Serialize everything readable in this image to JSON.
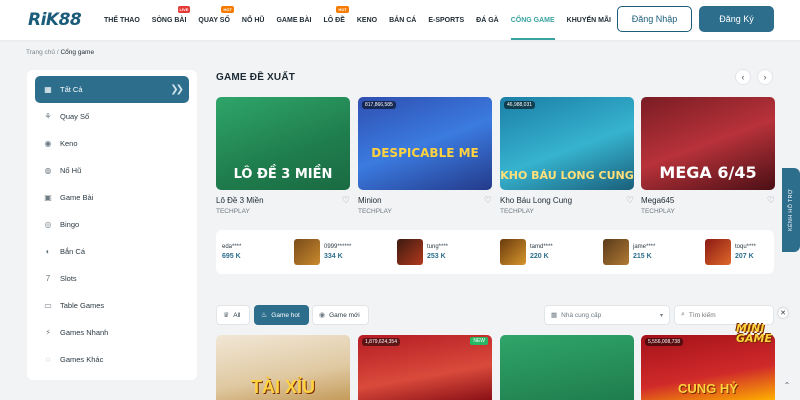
{
  "header": {
    "logo": "RiK88",
    "nav": [
      {
        "label": "THỂ THAO",
        "badge": ""
      },
      {
        "label": "SÒNG BÀI",
        "badge": "LIVE"
      },
      {
        "label": "QUAY SỐ",
        "badge": "HOT"
      },
      {
        "label": "NỔ HŨ",
        "badge": ""
      },
      {
        "label": "GAME BÀI",
        "badge": ""
      },
      {
        "label": "LÔ ĐỀ",
        "badge": "HOT"
      },
      {
        "label": "KENO",
        "badge": ""
      },
      {
        "label": "BẮN CÁ",
        "badge": ""
      },
      {
        "label": "E-SPORTS",
        "badge": ""
      },
      {
        "label": "ĐÁ GÀ",
        "badge": ""
      },
      {
        "label": "CỔNG GAME",
        "badge": ""
      },
      {
        "label": "KHUYẾN MÃI",
        "badge": ""
      }
    ],
    "active_nav": "CỔNG GAME",
    "login": "Đăng Nhập",
    "register": "Đăng Ký"
  },
  "breadcrumb": {
    "home": "Trang chủ",
    "sep": "/",
    "current": "Cổng game"
  },
  "sidebar": {
    "items": [
      {
        "label": "Tất Cả",
        "icon": "grid-icon"
      },
      {
        "label": "Quay Số",
        "icon": "lottery-icon"
      },
      {
        "label": "Keno",
        "icon": "keno-icon"
      },
      {
        "label": "Nổ Hũ",
        "icon": "jackpot-icon"
      },
      {
        "label": "Game Bài",
        "icon": "cards-icon"
      },
      {
        "label": "Bingo",
        "icon": "bingo-icon"
      },
      {
        "label": "Bắn Cá",
        "icon": "fish-icon"
      },
      {
        "label": "Slots",
        "icon": "slot-icon"
      },
      {
        "label": "Table Games",
        "icon": "table-icon"
      },
      {
        "label": "Games Nhanh",
        "icon": "fast-icon"
      },
      {
        "label": "Games Khác",
        "icon": "other-icon"
      }
    ]
  },
  "featured": {
    "title": "GAME ĐỀ XUẤT",
    "games": [
      {
        "name": "Lô Đề 3 Miền",
        "provider": "TECHPLAY",
        "views": "",
        "art": "LÔ ĐỀ 3 MIỀN"
      },
      {
        "name": "Minion",
        "provider": "TECHPLAY",
        "views": "817,866,585",
        "art": "DESPICABLE ME"
      },
      {
        "name": "Kho Báu Long Cung",
        "provider": "TECHPLAY",
        "views": "46,988,031",
        "art": "KHO BÁU LONG CUNG"
      },
      {
        "name": "Mega645",
        "provider": "TECHPLAY",
        "views": "",
        "art": "MEGA 6/45"
      }
    ]
  },
  "winners": [
    {
      "name": "eda****",
      "amount": "695 K"
    },
    {
      "name": "0999******",
      "amount": "334 K"
    },
    {
      "name": "tung****",
      "amount": "253 K"
    },
    {
      "name": "tamd****",
      "amount": "220 K"
    },
    {
      "name": "jame****",
      "amount": "215 K"
    },
    {
      "name": "toqu****",
      "amount": "207 K"
    }
  ],
  "filters": {
    "all": "All",
    "hot": "Game hot",
    "new": "Game mới",
    "provider_placeholder": "Nhà cung cấp",
    "search_placeholder": "Tìm kiếm"
  },
  "bottom_games": [
    {
      "views": "",
      "art": "TÀI XỈU",
      "tag": ""
    },
    {
      "views": "1,879,624,354",
      "art": "",
      "tag": "NEW"
    },
    {
      "views": "",
      "art": "",
      "tag": ""
    },
    {
      "views": "5,556,008,738",
      "art": "CUNG HỶ",
      "tag": ""
    }
  ],
  "side_tab": "KÊNH HỖ TRỢ",
  "mini_game": "MINI GAME"
}
